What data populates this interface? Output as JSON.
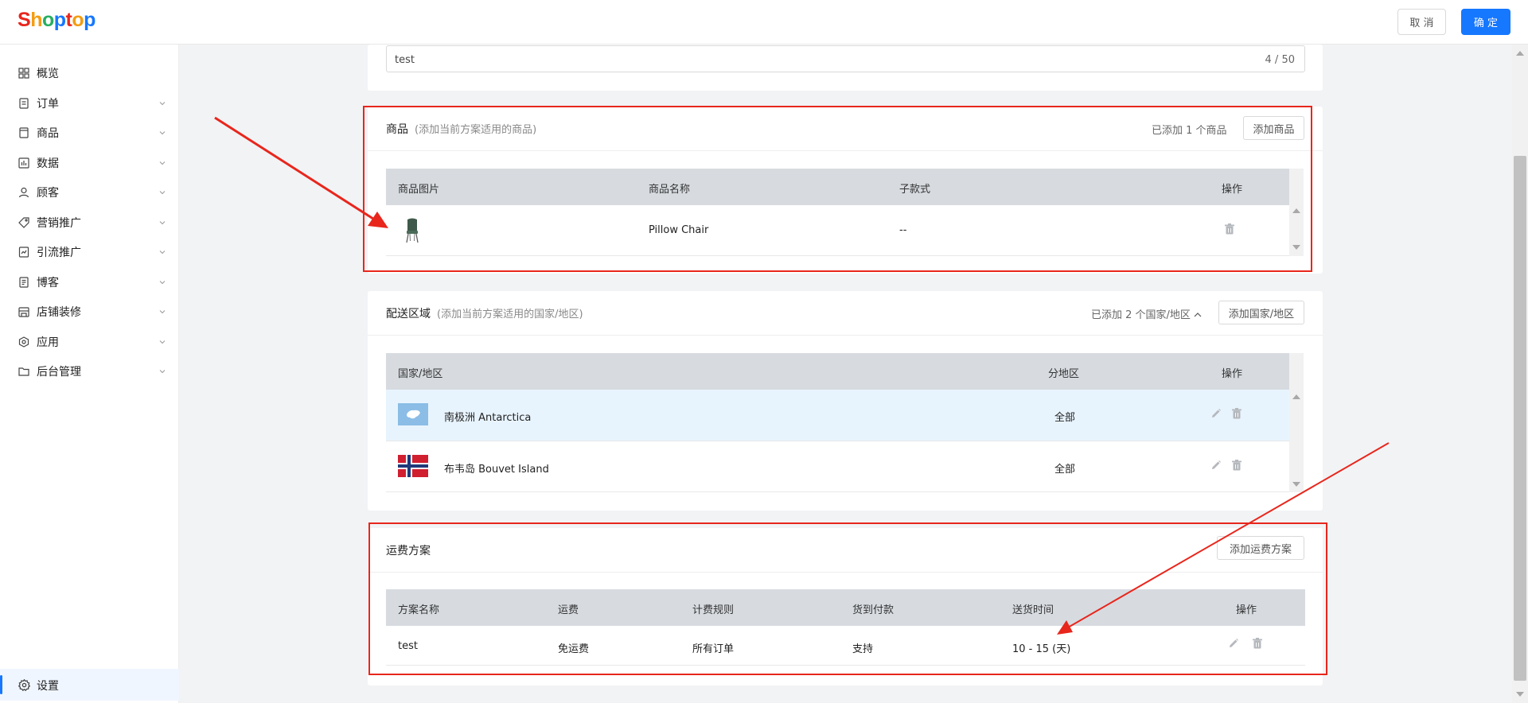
{
  "brand": {
    "logo_text": "Shoptop"
  },
  "header": {
    "cancel_label": "取 消",
    "confirm_label": "确 定"
  },
  "sidebar": {
    "items": [
      {
        "label": "概览",
        "icon": "dashboard-icon",
        "has_children": false
      },
      {
        "label": "订单",
        "icon": "order-icon",
        "has_children": true
      },
      {
        "label": "商品",
        "icon": "product-icon",
        "has_children": true
      },
      {
        "label": "数据",
        "icon": "chart-icon",
        "has_children": true
      },
      {
        "label": "顾客",
        "icon": "user-icon",
        "has_children": true
      },
      {
        "label": "营销推广",
        "icon": "tag-icon",
        "has_children": true
      },
      {
        "label": "引流推广",
        "icon": "traffic-icon",
        "has_children": true
      },
      {
        "label": "博客",
        "icon": "blog-icon",
        "has_children": true
      },
      {
        "label": "店铺装修",
        "icon": "store-icon",
        "has_children": true
      },
      {
        "label": "应用",
        "icon": "app-icon",
        "has_children": true
      },
      {
        "label": "后台管理",
        "icon": "folder-icon",
        "has_children": true
      }
    ],
    "settings_label": "设置"
  },
  "name_input": {
    "value": "test",
    "count": "4 / 50"
  },
  "products_section": {
    "title": "商品",
    "subtitle": "(添加当前方案适用的商品)",
    "added_text": "已添加 1 个商品",
    "add_button": "添加商品",
    "columns": [
      "商品图片",
      "商品名称",
      "子款式",
      "操作"
    ],
    "rows": [
      {
        "image": "chair-thumbnail",
        "name": "Pillow Chair",
        "variant": "--"
      }
    ]
  },
  "zones_section": {
    "title": "配送区域",
    "subtitle": "(添加当前方案适用的国家/地区)",
    "added_text": "已添加 2 个国家/地区",
    "add_button": "添加国家/地区",
    "columns": [
      "国家/地区",
      "分地区",
      "操作"
    ],
    "rows": [
      {
        "flag": "antarctica-flag",
        "name": "南极洲 Antarctica",
        "region": "全部"
      },
      {
        "flag": "norway-flag",
        "name": "布韦岛 Bouvet Island",
        "region": "全部"
      }
    ]
  },
  "rates_section": {
    "title": "运费方案",
    "add_button": "添加运费方案",
    "columns": [
      "方案名称",
      "运费",
      "计费规则",
      "货到付款",
      "送货时间",
      "操作"
    ],
    "rows": [
      {
        "name": "test",
        "fee": "免运费",
        "rule": "所有订单",
        "cod": "支持",
        "delivery": "10 - 15 (天)"
      }
    ]
  },
  "colors": {
    "primary": "#1677ff",
    "annotation": "#e8261c",
    "table_header": "#d7dbe0",
    "row_highlight": "#e8f4fd"
  }
}
